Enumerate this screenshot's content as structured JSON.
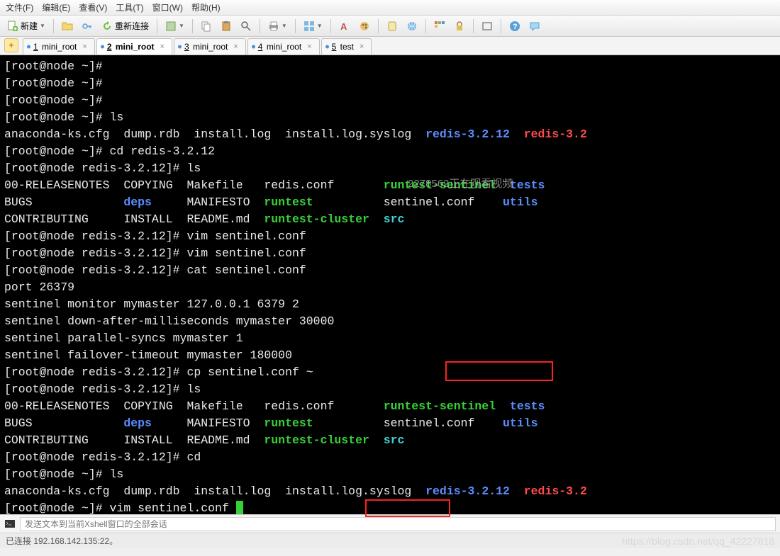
{
  "menu": {
    "file": "文件(F)",
    "edit": "编辑(E)",
    "view": "查看(V)",
    "tools": "工具(T)",
    "window": "窗口(W)",
    "help": "帮助(H)"
  },
  "toolbar": {
    "new": "新建",
    "reconnect": "重新连接"
  },
  "tabs": [
    {
      "num": "1",
      "label": "mini_root"
    },
    {
      "num": "2",
      "label": "mini_root"
    },
    {
      "num": "3",
      "label": "mini_root"
    },
    {
      "num": "4",
      "label": "mini_root"
    },
    {
      "num": "5",
      "label": "test"
    }
  ],
  "inputbar": {
    "placeholder": "发送文本到当前Xshell窗口的全部会话"
  },
  "statusbar": {
    "left": "已连接 192.168.142.135:22。",
    "right": "https://blog.csdn.net/qq_42227818"
  },
  "watermark": "2278562正在观看视频",
  "term": {
    "p1": "[root@node ~]# ",
    "p2": "[root@node ~]# ",
    "p3": "[root@node ~]# ",
    "p4": "[root@node ~]# ls",
    "ls_home_1": "anaconda-ks.cfg  dump.rdb  install.log  install.log.syslog  ",
    "ls_home_1_blue": "redis-3.2.12",
    "ls_home_1_red": "redis-3.2",
    "p5": "[root@node ~]# cd redis-3.2.12",
    "p6": "[root@node redis-3.2.12]# ls",
    "ls_a1": "00-RELEASENOTES  COPYING  Makefile   redis.conf       ",
    "ls_a1g": "runtest-sentinel",
    "ls_a1b": "tests",
    "ls_a2": "BUGS             ",
    "ls_a2d": "deps",
    "ls_a2m": "     MANIFESTO  ",
    "ls_a2r": "runtest",
    "ls_a2s": "          sentinel.conf    ",
    "ls_a2u": "utils",
    "ls_a3": "CONTRIBUTING     INSTALL  README.md  ",
    "ls_a3r": "runtest-cluster",
    "ls_a3s": "src",
    "p7": "[root@node redis-3.2.12]# vim sentinel.conf",
    "p8": "[root@node redis-3.2.12]# vim sentinel.conf",
    "p9": "[root@node redis-3.2.12]# cat sentinel.conf",
    "c1": "port 26379",
    "c2": "sentinel monitor mymaster 127.0.0.1 6379 2",
    "c3": "sentinel down-after-milliseconds mymaster 30000",
    "c4": "sentinel parallel-syncs mymaster 1",
    "c5": "sentinel failover-timeout mymaster 180000",
    "p10": "[root@node redis-3.2.12]# cp sentinel.conf ~",
    "p11": "[root@node redis-3.2.12]# ls",
    "p12": "[root@node redis-3.2.12]# cd",
    "p13": "[root@node ~]# ls",
    "p14": "[root@node ~]# vim sentinel.conf "
  }
}
